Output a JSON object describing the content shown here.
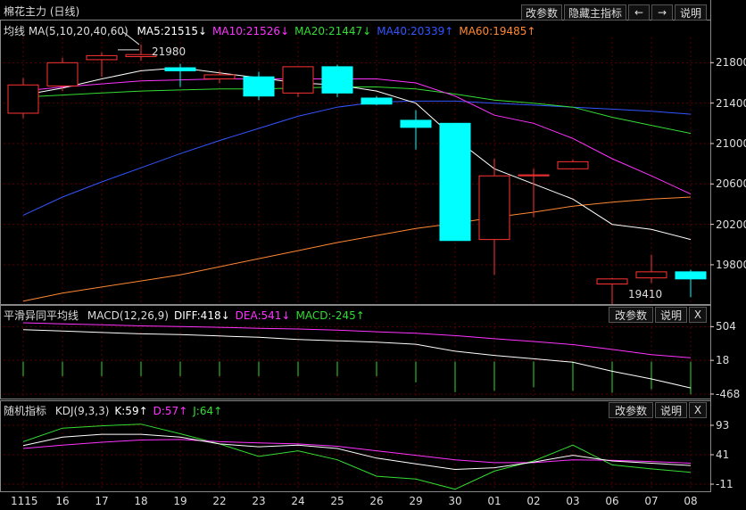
{
  "window": {
    "title": "棉花主力 (日线)",
    "buttons": [
      "改参数",
      "隐藏主指标",
      "←",
      "→",
      "说明"
    ]
  },
  "main": {
    "legend_prefix": "均线 MA(5,10,20,40,60)",
    "legend": [
      {
        "text": "MA5:21515↓",
        "color": "#ffffff"
      },
      {
        "text": "MA10:21526↓",
        "color": "#ff33ff"
      },
      {
        "text": "MA20:21447↓",
        "color": "#33dd33"
      },
      {
        "text": "MA40:20339↑",
        "color": "#3355ff"
      },
      {
        "text": "MA60:19485↑",
        "color": "#ff8833"
      }
    ],
    "high_label": "21980",
    "low_label": "19410",
    "y_ticks": [
      "21800",
      "21400",
      "21000",
      "20600",
      "20200",
      "19800"
    ]
  },
  "macd": {
    "title": "平滑异同平均线",
    "legend": [
      {
        "text": "MACD(12,26,9)",
        "color": "#dddddd"
      },
      {
        "text": "DIFF:418↓",
        "color": "#ffffff"
      },
      {
        "text": "DEA:541↓",
        "color": "#ff33ff"
      },
      {
        "text": "MACD:-245↑",
        "color": "#33dd33"
      }
    ],
    "buttons": [
      "改参数",
      "说明",
      "X"
    ],
    "y_ticks": [
      "504",
      "18",
      "-468"
    ]
  },
  "kdj": {
    "title": "随机指标",
    "legend": [
      {
        "text": "KDJ(9,3,3)",
        "color": "#dddddd"
      },
      {
        "text": "K:59↑",
        "color": "#ffffff"
      },
      {
        "text": "D:57↑",
        "color": "#ff33ff"
      },
      {
        "text": "J:64↑",
        "color": "#33dd33"
      }
    ],
    "buttons": [
      "改参数",
      "说明",
      "X"
    ],
    "y_ticks": [
      "93",
      "41",
      "-11"
    ]
  },
  "colors": {
    "up": "#ff3333",
    "down": "#00ffff",
    "grid": "#5a0000",
    "border": "#888888",
    "ma5": "#ffffff",
    "ma10": "#ff33ff",
    "ma20": "#33dd33",
    "ma40": "#3355ff",
    "ma60": "#ff8833"
  },
  "chart_data": {
    "type": "candlestick",
    "dates": [
      "1115",
      "16",
      "17",
      "18",
      "19",
      "22",
      "23",
      "24",
      "25",
      "26",
      "29",
      "30",
      "01",
      "02",
      "03",
      "06",
      "07",
      "08"
    ],
    "ohlc": [
      [
        21300,
        21650,
        21250,
        21580
      ],
      [
        21570,
        21850,
        21520,
        21800
      ],
      [
        21830,
        21900,
        21660,
        21870
      ],
      [
        21860,
        21980,
        21820,
        21880
      ],
      [
        21750,
        21790,
        21560,
        21720
      ],
      [
        21640,
        21720,
        21600,
        21680
      ],
      [
        21660,
        21710,
        21430,
        21470
      ],
      [
        21500,
        21760,
        21460,
        21760
      ],
      [
        21760,
        21780,
        21460,
        21500
      ],
      [
        21450,
        21470,
        21380,
        21390
      ],
      [
        21230,
        21330,
        20940,
        21160
      ],
      [
        21200,
        21200,
        20040,
        20040
      ],
      [
        20050,
        20850,
        19700,
        20680
      ],
      [
        20680,
        20750,
        20270,
        20690
      ],
      [
        20750,
        20840,
        20740,
        20820
      ],
      [
        19610,
        19670,
        19410,
        19660
      ],
      [
        19670,
        19900,
        19620,
        19730
      ],
      [
        19730,
        19750,
        19480,
        19660
      ]
    ],
    "ma5": [
      21480,
      21550,
      21640,
      21720,
      21750,
      21700,
      21650,
      21600,
      21580,
      21520,
      21400,
      21050,
      20750,
      20600,
      20450,
      20200,
      20150,
      20050
    ],
    "ma10": [
      21520,
      21560,
      21590,
      21620,
      21630,
      21640,
      21640,
      21640,
      21640,
      21640,
      21600,
      21470,
      21280,
      21200,
      21050,
      20850,
      20680,
      20500
    ],
    "ma20": [
      21460,
      21480,
      21500,
      21520,
      21530,
      21540,
      21540,
      21550,
      21560,
      21560,
      21540,
      21490,
      21430,
      21400,
      21360,
      21260,
      21180,
      21100
    ],
    "ma40": [
      20290,
      20470,
      20620,
      20760,
      20900,
      21030,
      21150,
      21270,
      21360,
      21410,
      21420,
      21420,
      21400,
      21380,
      21360,
      21340,
      21320,
      21290
    ],
    "ma60": [
      19440,
      19520,
      19580,
      19640,
      19700,
      19780,
      19860,
      19940,
      20020,
      20090,
      20160,
      20210,
      20270,
      20320,
      20380,
      20420,
      20450,
      20470
    ],
    "price_range": [
      19420,
      22050
    ],
    "macd_diff": [
      460,
      440,
      420,
      400,
      390,
      370,
      350,
      320,
      300,
      280,
      250,
      150,
      90,
      40,
      -10,
      -140,
      -250,
      -380
    ],
    "macd_dea": [
      560,
      545,
      530,
      515,
      505,
      495,
      480,
      470,
      455,
      430,
      410,
      375,
      330,
      290,
      245,
      175,
      100,
      55
    ],
    "macd_bar": [
      -210,
      -210,
      -210,
      -210,
      -210,
      -210,
      -210,
      -210,
      -210,
      -210,
      -300,
      -440,
      -420,
      -370,
      -420,
      -450,
      -400,
      -470
    ],
    "macd_range": [
      -520,
      560
    ],
    "kdj_k": [
      57,
      72,
      77,
      77,
      72,
      60,
      55,
      58,
      52,
      35,
      25,
      15,
      18,
      28,
      40,
      30,
      26,
      22
    ],
    "kdj_d": [
      52,
      58,
      63,
      67,
      68,
      64,
      62,
      60,
      56,
      48,
      40,
      32,
      27,
      27,
      32,
      31,
      29,
      26
    ],
    "kdj_j": [
      64,
      88,
      92,
      95,
      78,
      60,
      38,
      48,
      32,
      3,
      -2,
      -20,
      12,
      30,
      58,
      23,
      16,
      10
    ],
    "kdj_range": [
      -22,
      104
    ]
  }
}
